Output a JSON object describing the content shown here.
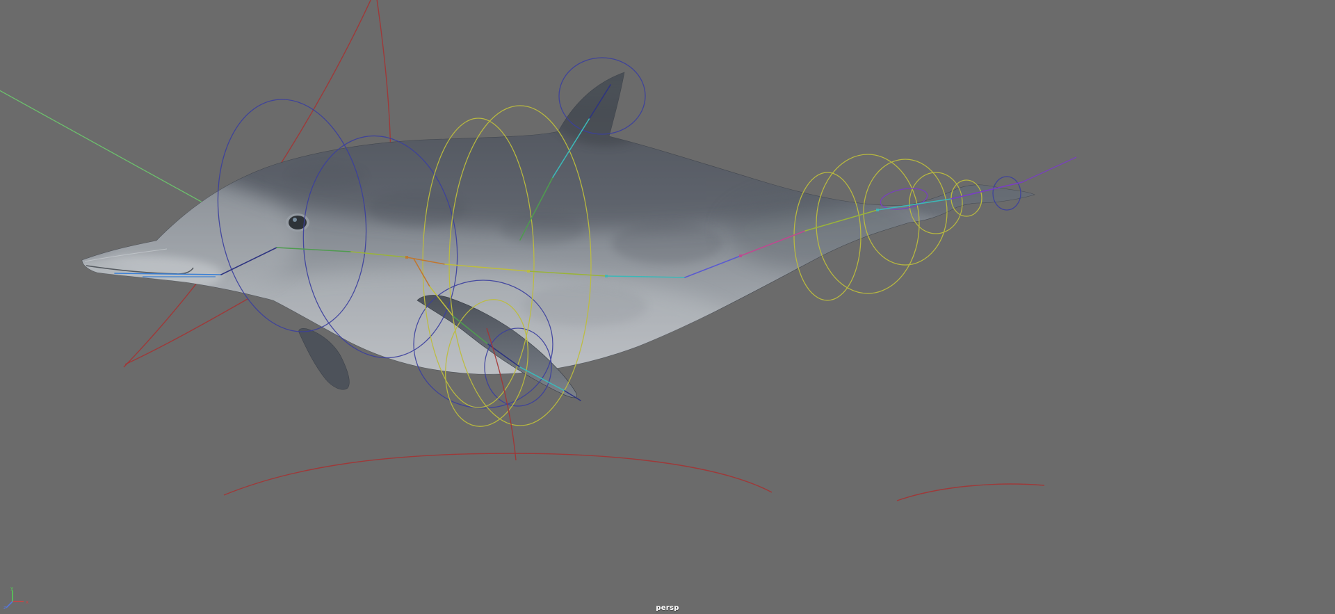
{
  "viewport": {
    "camera_label": "persp",
    "background_color": "#6b6b6b"
  },
  "axis_gizmo": {
    "x_label": "x",
    "y_label": "y",
    "z_label": "z",
    "x_color": "#cc4444",
    "y_color": "#55cc55",
    "z_color": "#5577dd"
  },
  "scene": {
    "model_name": "dolphin",
    "rig_colors": {
      "spine_ring_controls": "#bdbd3e",
      "head_and_fin_ring_controls": "#3b3f9e",
      "global_root_control": "#a43434",
      "aim_line": "#6cc06c",
      "joint_chain_segments": [
        "#3b7fd4",
        "#2e3480",
        "#4f9b4f",
        "#9ab33a",
        "#c07830",
        "#bdbd3e",
        "#3cb8b8",
        "#5a5ad0",
        "#c04890",
        "#7a3cc8"
      ]
    }
  }
}
